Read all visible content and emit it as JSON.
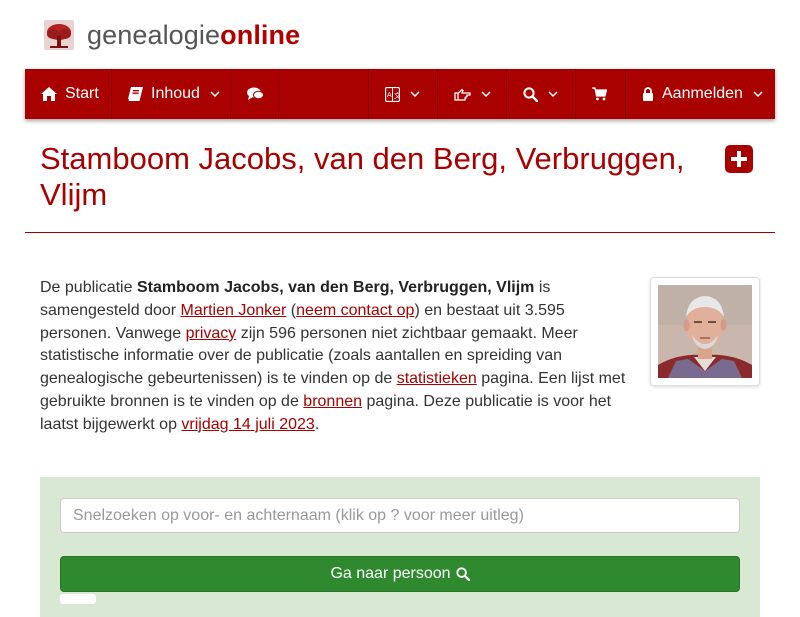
{
  "logo": {
    "part1": "genealogie",
    "part2": "online",
    "icon": "tree-icon"
  },
  "nav": {
    "start": {
      "label": "Start",
      "icon": "home-icon"
    },
    "inhoud": {
      "label": "Inhoud",
      "icon": "book-icon"
    },
    "comments_icon": "comments-icon",
    "language_icon": "language-icon",
    "share_icon": "hand-point-icon",
    "search_icon": "search-icon",
    "cart_icon": "cart-icon",
    "login": {
      "label": "Aanmelden",
      "icon": "lock-icon"
    }
  },
  "page": {
    "title": "Stamboom Jacobs, van den Berg, Verbruggen, Vlijm",
    "add_icon": "plus-square-icon"
  },
  "description": {
    "t1": "De publicatie ",
    "pub_name": "Stamboom Jacobs, van den Berg, Verbruggen, Vlijm",
    "t2": " is samengesteld door ",
    "author": "Martien Jonker",
    "t3": " (",
    "contact": "neem contact op",
    "t4": ") en bestaat uit 3.595 personen. Vanwege ",
    "privacy": "privacy",
    "t5": " zijn 596 personen niet zichtbaar gemaakt. Meer statistische informatie over de publicatie (zoals aantallen en spreiding van genealogische gebeurtenissen) is te vinden op de ",
    "stats": "statistieken",
    "t6": " pagina. Een lijst met gebruikte bronnen is te vinden op de ",
    "sources": "bronnen",
    "t7": " pagina. Deze publicatie is voor het laatst bijgewerkt op ",
    "date": "vrijdag 14 juli 2023",
    "t8": "."
  },
  "search": {
    "placeholder": "Snelzoeken op voor- en achternaam (klik op ? voor meer uitleg)",
    "button_label": "Ga naar persoon"
  },
  "colors": {
    "brand": "#a90000",
    "panel": "#d9e8d3",
    "go": "#2f8a2f"
  }
}
